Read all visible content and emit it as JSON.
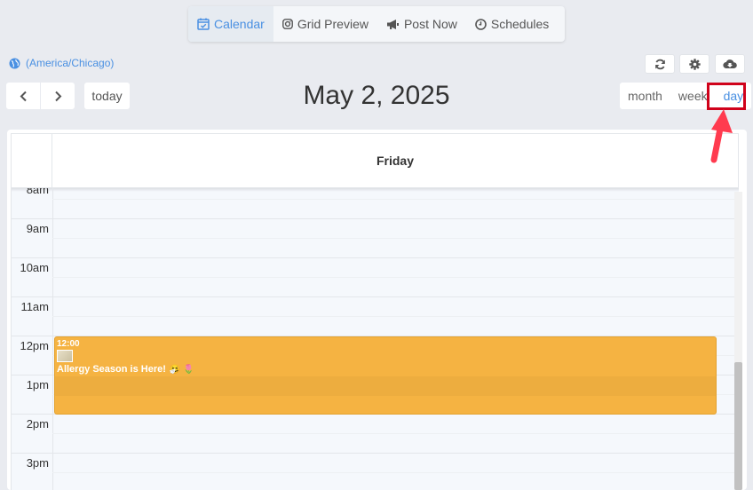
{
  "nav": {
    "tabs": [
      {
        "label": "Calendar",
        "icon": "calendar-check-icon",
        "active": true
      },
      {
        "label": "Grid Preview",
        "icon": "instagram-icon",
        "active": false
      },
      {
        "label": "Post Now",
        "icon": "megaphone-icon",
        "active": false
      },
      {
        "label": "Schedules",
        "icon": "clock-icon",
        "active": false
      }
    ]
  },
  "timezone": "(America/Chicago)",
  "toolbar": {
    "prev_icon": "chevron-left-icon",
    "next_icon": "chevron-right-icon",
    "today_label": "today",
    "title": "May 2, 2025",
    "views": [
      "month",
      "week",
      "day"
    ],
    "active_view": "day",
    "actions": [
      "refresh-icon",
      "gear-icon",
      "cloud-download-icon"
    ]
  },
  "calendar": {
    "day_header": "Friday",
    "hours": [
      "8am",
      "9am",
      "10am",
      "11am",
      "12pm",
      "1pm",
      "2pm",
      "3pm"
    ],
    "events": [
      {
        "time": "12:00",
        "title": "Allergy Season is Here!",
        "emoji": "🤧 🌷",
        "color": "#f5b342"
      }
    ]
  },
  "colors": {
    "accent": "#4a90e2",
    "event": "#f5b342",
    "annotation": "#d0021b",
    "arrow": "#ff3b4f"
  }
}
